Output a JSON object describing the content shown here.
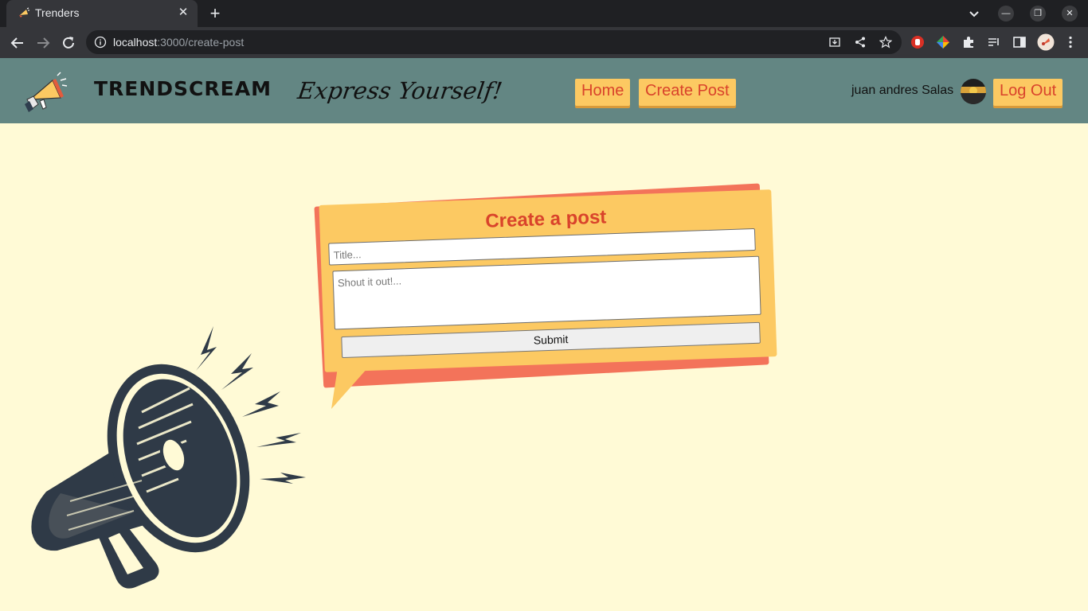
{
  "browser": {
    "tab_title": "Trenders",
    "url_host": "localhost",
    "url_path": ":3000/create-post"
  },
  "header": {
    "brand": "TRENDSCREAM",
    "tagline": "Express Yourself!",
    "nav": {
      "home": "Home",
      "create_post": "Create Post"
    },
    "user_name": "juan andres Salas",
    "logout": "Log Out"
  },
  "post_form": {
    "heading": "Create a post",
    "title_placeholder": "Title...",
    "body_placeholder": "Shout it out!...",
    "submit_label": "Submit"
  },
  "colors": {
    "header_bg": "#638683",
    "page_bg": "#fffad6",
    "accent_yellow": "#fcc962",
    "accent_red": "#d9432b",
    "card_shadow": "#f3735a"
  }
}
